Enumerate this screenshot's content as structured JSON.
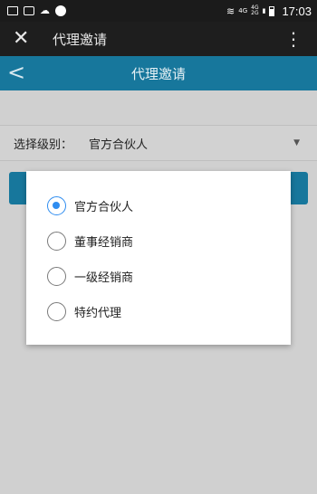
{
  "status_bar": {
    "network_top": "4G",
    "network_dual_top": "4G",
    "network_dual_bottom": "2G",
    "time": "17:03"
  },
  "app_bar": {
    "title": "代理邀请"
  },
  "page_header": {
    "title": "代理邀请"
  },
  "form": {
    "level_label": "选择级别：",
    "level_value": "官方合伙人"
  },
  "dialog": {
    "options": [
      {
        "label": "官方合伙人",
        "checked": true
      },
      {
        "label": "董事经销商",
        "checked": false
      },
      {
        "label": "一级经销商",
        "checked": false
      },
      {
        "label": "特约代理",
        "checked": false
      }
    ]
  },
  "colors": {
    "header_blue": "#17779c",
    "radio_accent": "#2f8df0"
  }
}
